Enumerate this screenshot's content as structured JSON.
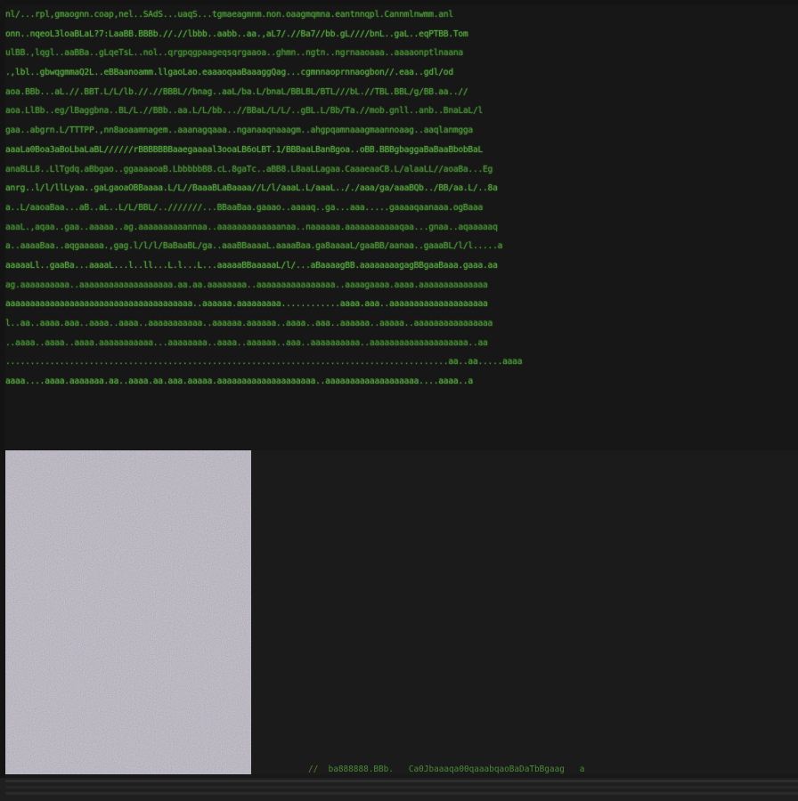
{
  "terminal": {
    "lines": [
      "nl/...rpl,gmaognn.coap,nel..SAdS...uaqS...tgmaeagmnm.non.oaagmqmna.eantnnqpl.Cannmlnwmm.anl",
      "onn..nqeoL3loaBLaL?7:LaaBB.BBBb.//.//lbbb..aabb..aa.,aL7/.//Ba7//bb.gL////bnL..gaL..eqPTBB.Tom",
      "ulBB.,lqgl..aaBBa..gLqeTsL..nol..qrgpqgpaageqsqrgaaoa..ghmn..ngtn..ngrnaaoaaa..aaaaonptlnaana",
      ".,lbl..gbwqgmmaQ2L..eBBaanoamm.llgaoLao.eaaaoqaaBaaaggQag...cgmnnaoprnnaogbon//.eaa..gdl/od",
      "aoa.BBb...aL.//.BBT.L/L/lb.//.//BBBL//bnag..aaL/ba.L/bnaL/BBLBL/BTL///bL.//TBL.BBL/g/BB.aa..//",
      "aoa.LlBb..eg/lBaggbna..BL/L.//BBb..aa.L/L/bb...//BBaL/L/L/..gBL.L/Bb/Ta.//mob.gnll..anb..BnaLaL/l",
      "gaa..abgrn.L/TTTPP.,nn8aoaamnagem..aaanagqaaa..nganaaqnaaagm..ahgpqamnaaagmaannoaag..aaqlanmgga",
      "aaaLa0Boa3aBoLbaLaBL//////rBBBBBBBaaegaaaal3ooaLB6oLBT.1/BBBaaLBanBgoa..oBB.BBBgbaggaBaBaaBbobBaL",
      "anaBLL8..LlTgdq.aBbgao..ggaaaaoaB.LbbbbbBB.cL.8gaTc..aBB8.L8aaLLagaa.CaaaeaaCB.L/alaaLL//aoaBa...Eg",
      "anrg..l/l/llLyaa..gaLgaoaOBBaaaa.L/L//BaaaBLaBaaaa//L/l/aaaL.L/aaaL.././aaa/ga/aaaBQb../BB/aa.L/..8a",
      "a..L/aaoaBaa...aB..aL..L/L/BBL/..///////...BBaaBaa.gaaao..aaaaq..ga...aaa.....gaaaaqaanaaa.ogBaaa",
      "aaaL.,aqaa..gaa..aaaaa..ag.aaaaaaaaaannaa..aaaaaaaaaaaaanaa..naaaaaa.aaaaaaaaaaaqaa...gnaa..aqaaaaaq",
      "a..aaaaBaa..aqgaaaaa.,gag.l/l/l/BaBaaBL/ga..aaaBBaaaaL.aaaaBaa.ga8aaaaL/gaaBB/aanaa..gaaaBL/l/l.....a",
      "aaaaaLl..gaaBa...aaaaL...l..ll...L.l...L...aaaaaBBaaaaaL/l/...aBaaaagBB.aaaaaaaagagBBgaaBaaa.gaaa.aa",
      "ag.aaaaaaaaaa..aaaaaaaaaaaaaaaaaaa.aa.aa.aaaaaaaa..aaaaaaaaaaaaaaaa..aaaagaaaa.aaaa.aaaaaaaaaaaaaa",
      "aaaaaaaaaaaaaaaaaaaaaaaaaaaaaaaaaaaaaa..aaaaaa.aaaaaaaaa............aaaa.aaa..aaaaaaaaaaaaaaaaaaaa",
      "l..aa..aaaa.aaa..aaaa..aaaa..aaaaaaaaaaa..aaaaaa.aaaaaa..aaaa..aaa..aaaaaa..aaaaa..aaaaaaaaaaaaaaaa",
      "..aaaa..aaaa..aaaa.aaaaaaaaaaa...aaaaaaaa..aaaa..aaaaaa..aaa..aaaaaaaaaa..aaaaaaaaaaaaaaaaaaaa..aa",
      "..........................................................................................aa..aa.....aaaa",
      "aaaa....aaaa.aaaaaaa.aa..aaaa.aa.aaa.aaaaa.aaaaaaaaaaaaaaaaaaaa..aaaaaaaaaaaaaaaaaaa....aaaa..a"
    ],
    "status": "//  ba888888.BBb.   Ca0Jbaaaqa00qaaabqaoBaDaTbBgaag   a"
  },
  "colors": {
    "background": "#181818",
    "text": "#4c8f3a",
    "noise_base": "#8c8a92"
  }
}
